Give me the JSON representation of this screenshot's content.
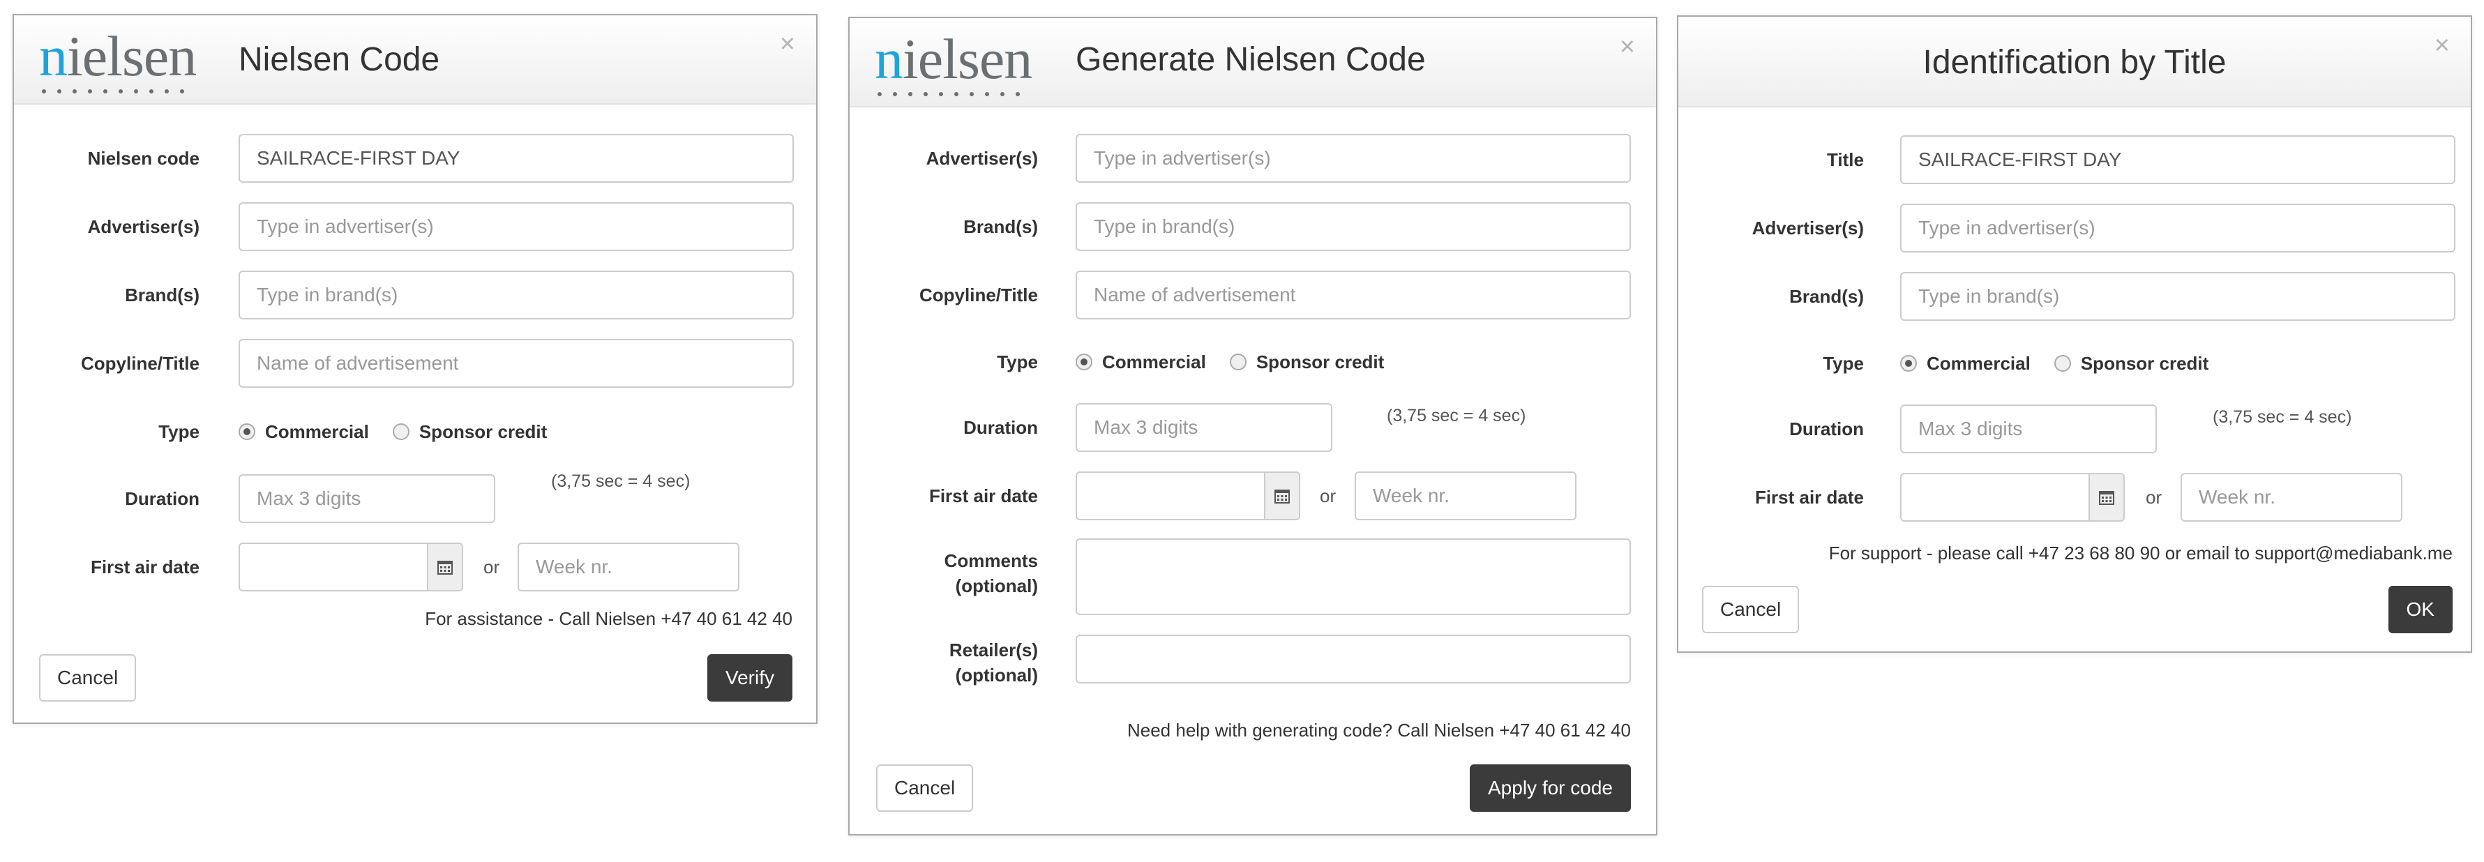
{
  "logo_text": "nielsen",
  "calendar_icon": "calendar-icon",
  "dialogs": {
    "verify": {
      "title": "Nielsen Code",
      "close": "×",
      "fields": {
        "nielsen_code": {
          "label": "Nielsen code",
          "value": "SAILRACE-FIRST DAY"
        },
        "advertisers": {
          "label": "Advertiser(s)",
          "placeholder": "Type in advertiser(s)"
        },
        "brands": {
          "label": "Brand(s)",
          "placeholder": "Type in brand(s)"
        },
        "copyline": {
          "label": "Copyline/Title",
          "placeholder": "Name of advertisement"
        },
        "type": {
          "label": "Type",
          "options": [
            "Commercial",
            "Sponsor credit"
          ],
          "selected": "Commercial"
        },
        "duration": {
          "label": "Duration",
          "placeholder": "Max 3 digits",
          "hint": "(3,75 sec = 4 sec)"
        },
        "first_air_date": {
          "label": "First air date",
          "or": "or",
          "week_placeholder": "Week nr."
        }
      },
      "help": "For assistance - Call Nielsen +47 40 61 42 40",
      "cancel": "Cancel",
      "submit": "Verify"
    },
    "generate": {
      "title": "Generate Nielsen Code",
      "close": "×",
      "fields": {
        "advertisers": {
          "label": "Advertiser(s)",
          "placeholder": "Type in advertiser(s)"
        },
        "brands": {
          "label": "Brand(s)",
          "placeholder": "Type in brand(s)"
        },
        "copyline": {
          "label": "Copyline/Title",
          "placeholder": "Name of advertisement"
        },
        "type": {
          "label": "Type",
          "options": [
            "Commercial",
            "Sponsor credit"
          ],
          "selected": "Commercial"
        },
        "duration": {
          "label": "Duration",
          "placeholder": "Max 3 digits",
          "hint": "(3,75 sec = 4 sec)"
        },
        "first_air_date": {
          "label": "First air date",
          "or": "or",
          "week_placeholder": "Week nr."
        },
        "comments": {
          "label_line1": "Comments",
          "label_line2": "(optional)"
        },
        "retailers": {
          "label_line1": "Retailer(s)",
          "label_line2": "(optional)"
        }
      },
      "help": "Need help with generating code? Call Nielsen +47 40 61 42 40",
      "cancel": "Cancel",
      "submit": "Apply for code"
    },
    "title": {
      "title": "Identification by Title",
      "close": "×",
      "fields": {
        "title": {
          "label": "Title",
          "value": "SAILRACE-FIRST DAY"
        },
        "advertisers": {
          "label": "Advertiser(s)",
          "placeholder": "Type in advertiser(s)"
        },
        "brands": {
          "label": "Brand(s)",
          "placeholder": "Type in brand(s)"
        },
        "type": {
          "label": "Type",
          "options": [
            "Commercial",
            "Sponsor credit"
          ],
          "selected": "Commercial"
        },
        "duration": {
          "label": "Duration",
          "placeholder": "Max 3 digits",
          "hint": "(3,75 sec = 4 sec)"
        },
        "first_air_date": {
          "label": "First air date",
          "or": "or",
          "week_placeholder": "Week nr."
        }
      },
      "help": "For support - please call +47 23 68 80 90 or email to support@mediabank.me",
      "cancel": "Cancel",
      "submit": "OK"
    }
  }
}
